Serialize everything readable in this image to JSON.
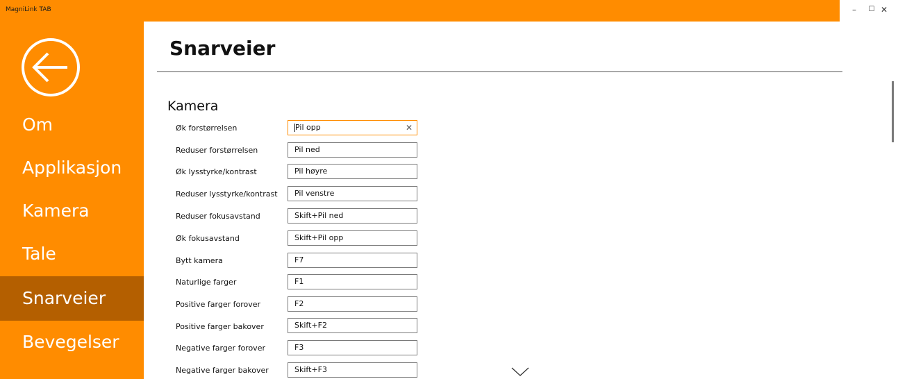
{
  "window": {
    "title": "MagniLink TAB",
    "controls": {
      "minimize": "–",
      "maximize": "☐",
      "close": "✕"
    }
  },
  "sidebar": {
    "items": [
      {
        "label": "Om"
      },
      {
        "label": "Applikasjon"
      },
      {
        "label": "Kamera"
      },
      {
        "label": "Tale"
      },
      {
        "label": "Snarveier",
        "selected": true
      },
      {
        "label": "Bevegelser"
      }
    ]
  },
  "page": {
    "title": "Snarveier",
    "section": "Kamera",
    "clear_glyph": "✕",
    "shortcuts": [
      {
        "label": "Øk forstørrelsen",
        "value": "Pil opp"
      },
      {
        "label": "Reduser forstørrelsen",
        "value": "Pil ned"
      },
      {
        "label": "Øk lysstyrke/kontrast",
        "value": "Pil høyre"
      },
      {
        "label": "Reduser lysstyrke/kontrast",
        "value": "Pil venstre"
      },
      {
        "label": "Reduser fokusavstand",
        "value": "Skift+Pil ned"
      },
      {
        "label": "Øk fokusavstand",
        "value": "Skift+Pil opp"
      },
      {
        "label": "Bytt kamera",
        "value": "F7"
      },
      {
        "label": "Naturlige farger",
        "value": "F1"
      },
      {
        "label": "Positive farger forover",
        "value": "F2"
      },
      {
        "label": "Positive farger bakover",
        "value": "Skift+F2"
      },
      {
        "label": "Negative farger forover",
        "value": "F3"
      },
      {
        "label": "Negative farger bakover",
        "value": "Skift+F3"
      }
    ]
  },
  "colors": {
    "accent": "#ff8c00",
    "selected": "#b45f00"
  }
}
